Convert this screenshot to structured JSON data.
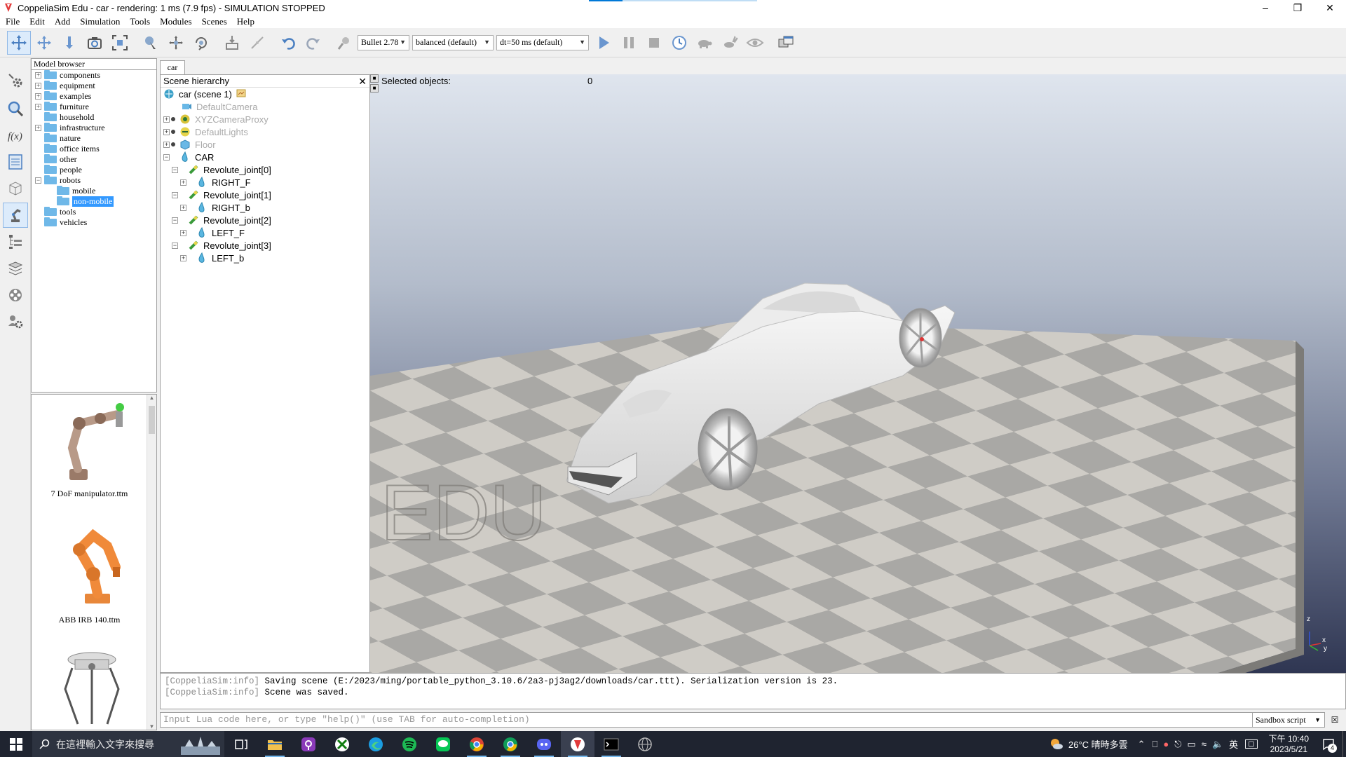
{
  "window": {
    "title": "CoppeliaSim Edu - car - rendering: 1 ms (7.9 fps) - SIMULATION STOPPED"
  },
  "menu": [
    "File",
    "Edit",
    "Add",
    "Simulation",
    "Tools",
    "Modules",
    "Scenes",
    "Help"
  ],
  "toolbar": {
    "engine": "Bullet 2.78",
    "accuracy": "balanced (default)",
    "dt": "dt=50 ms (default)"
  },
  "model_browser": {
    "header": "Model browser",
    "items": [
      {
        "label": "components",
        "expandable": true
      },
      {
        "label": "equipment",
        "expandable": true
      },
      {
        "label": "examples",
        "expandable": true
      },
      {
        "label": "furniture",
        "expandable": true
      },
      {
        "label": "household",
        "expandable": false
      },
      {
        "label": "infrastructure",
        "expandable": true
      },
      {
        "label": "nature",
        "expandable": false
      },
      {
        "label": "office items",
        "expandable": false
      },
      {
        "label": "other",
        "expandable": false
      },
      {
        "label": "people",
        "expandable": false
      },
      {
        "label": "robots",
        "expandable": true,
        "expanded": true
      },
      {
        "label": "mobile",
        "child": true
      },
      {
        "label": "non-mobile",
        "child": true,
        "selected": true
      },
      {
        "label": "tools",
        "expandable": false
      },
      {
        "label": "vehicles",
        "expandable": false
      }
    ],
    "thumbnails": [
      {
        "label": "7 DoF manipulator.ttm"
      },
      {
        "label": "ABB IRB 140.ttm"
      }
    ]
  },
  "doc_tab": "car",
  "scene_hierarchy": {
    "header": "Scene hierarchy",
    "rows": [
      {
        "label": "car (scene 1)",
        "indent": 0,
        "icon": "scene-icon",
        "muted": false
      },
      {
        "label": "DefaultCamera",
        "indent": 1,
        "icon": "camera-icon",
        "muted": true
      },
      {
        "label": "XYZCameraProxy",
        "indent": 1,
        "icon": "dummy-icon",
        "muted": true
      },
      {
        "label": "DefaultLights",
        "indent": 1,
        "icon": "light-icon",
        "muted": true
      },
      {
        "label": "Floor",
        "indent": 1,
        "icon": "cube-icon",
        "muted": true
      },
      {
        "label": "CAR",
        "indent": 1,
        "icon": "shape-icon",
        "muted": false
      },
      {
        "label": "Revolute_joint[0]",
        "indent": 2,
        "icon": "joint-icon",
        "muted": false
      },
      {
        "label": "RIGHT_F",
        "indent": 3,
        "icon": "shape-icon",
        "muted": false
      },
      {
        "label": "Revolute_joint[1]",
        "indent": 2,
        "icon": "joint-icon",
        "muted": false
      },
      {
        "label": "RIGHT_b",
        "indent": 3,
        "icon": "shape-icon",
        "muted": false
      },
      {
        "label": "Revolute_joint[2]",
        "indent": 2,
        "icon": "joint-icon",
        "muted": false
      },
      {
        "label": "LEFT_F",
        "indent": 3,
        "icon": "shape-icon",
        "muted": false
      },
      {
        "label": "Revolute_joint[3]",
        "indent": 2,
        "icon": "joint-icon",
        "muted": false
      },
      {
        "label": "LEFT_b",
        "indent": 3,
        "icon": "shape-icon",
        "muted": false
      }
    ]
  },
  "viewport": {
    "selected_label": "Selected objects:",
    "selected_count": "0",
    "watermark": "EDU",
    "axis_labels": {
      "z": "z",
      "x": "x",
      "y": "y"
    }
  },
  "console": {
    "lines": [
      {
        "tag": "[CoppeliaSim:info]",
        "text": " Saving scene (E:/2023/ming/portable_python_3.10.6/2a3-pj3ag2/downloads/car.ttt). Serialization version is 23."
      },
      {
        "tag": "[CoppeliaSim:info]",
        "text": " Scene was saved."
      }
    ],
    "input_placeholder": "Input Lua code here, or type \"help()\" (use TAB for auto-completion)",
    "script_mode": "Sandbox script"
  },
  "taskbar": {
    "search_placeholder": "在這裡輸入文字來搜尋",
    "weather": "26°C  晴時多雲",
    "ime": "英",
    "time": "下午 10:40",
    "date": "2023/5/21",
    "notifications": "4"
  }
}
